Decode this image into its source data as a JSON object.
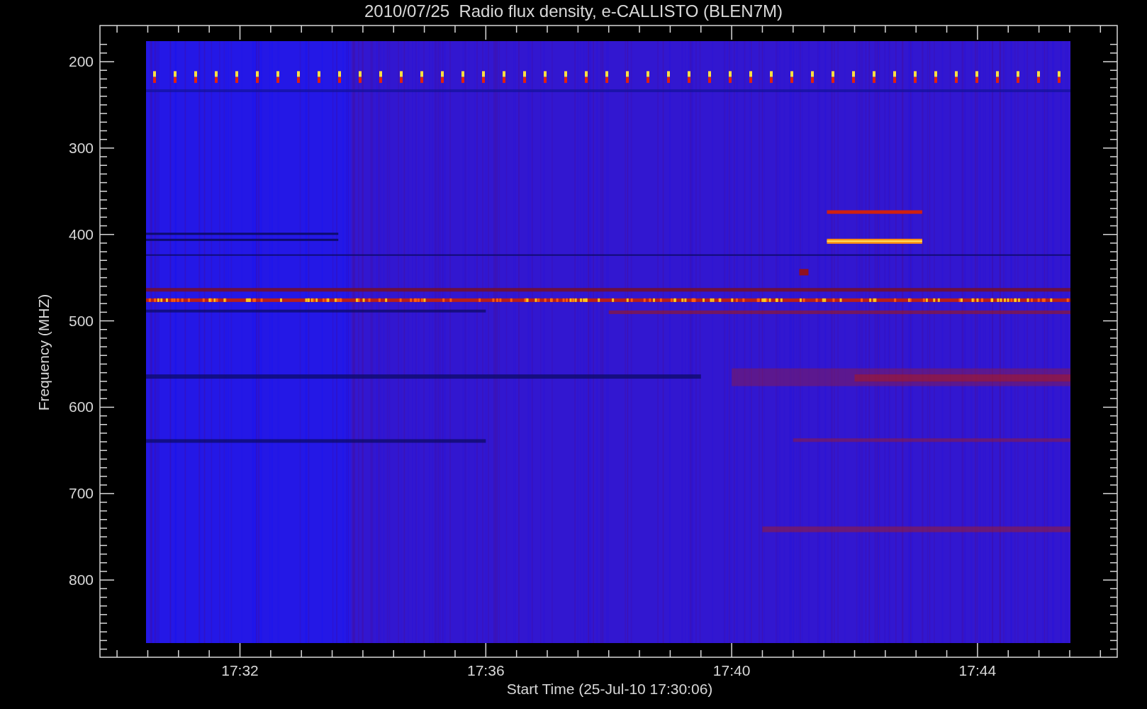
{
  "plot": {
    "title": "2010/07/25  Radio flux density, e-CALLISTO (BLEN7M)",
    "ylabel": "Frequency (MHZ)",
    "xlabel": "Start Time (25-Jul-10 17:30:06)",
    "yticks": [
      "200",
      "300",
      "400",
      "500",
      "600",
      "700",
      "800"
    ],
    "xticks": [
      "17:32",
      "17:36",
      "17:40",
      "17:44"
    ]
  }
}
